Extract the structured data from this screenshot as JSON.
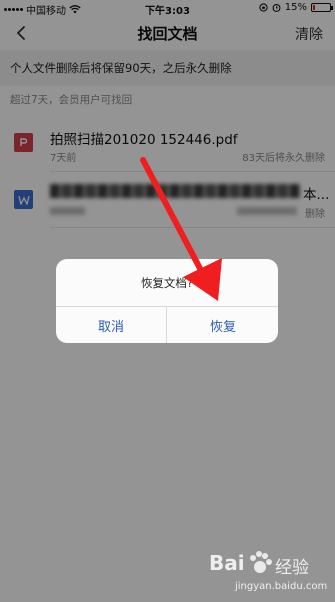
{
  "status_bar": {
    "carrier": "中国移动",
    "time": "下午3:03",
    "battery_percent": "15%",
    "battery_level": 0.15
  },
  "nav": {
    "title": "找回文档",
    "clear_label": "清除",
    "back_icon": "chevron-left-icon"
  },
  "info_banner": "个人文件删除后将保留90天，之后永久删除",
  "section_header": "超过7天，会员用户可找回",
  "files": [
    {
      "name": "拍照扫描201020 152446.pdf",
      "time": "7天前",
      "expiry": "83天后将永久删除",
      "icon": "pdf-file-icon",
      "icon_color": "#d0404a"
    },
    {
      "name": "本...",
      "time": "",
      "expiry": "删除",
      "icon": "word-file-icon",
      "icon_color": "#3c6fcd"
    }
  ],
  "dialog": {
    "message": "恢复文档?",
    "cancel_label": "取消",
    "confirm_label": "恢复"
  },
  "watermark": {
    "brand": "Bai",
    "brand2": "经验",
    "url": "jingyan.baidu.com"
  },
  "colors": {
    "accent_blue": "#2a5db0",
    "arrow_red": "#f01e1e",
    "banner_bg": "#f2f2f2"
  }
}
